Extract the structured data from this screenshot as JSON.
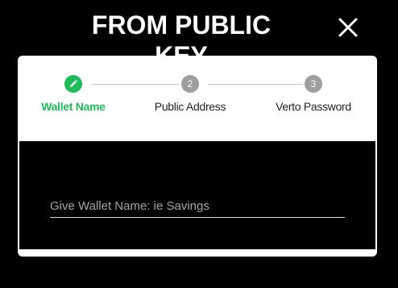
{
  "dialog": {
    "title": "FROM PUBLIC KEY",
    "close_icon": "close-icon"
  },
  "stepper": {
    "steps": [
      {
        "label": "Wallet Name",
        "number": "",
        "icon": "pencil-icon",
        "state": "active"
      },
      {
        "label": "Public Address",
        "number": "2",
        "state": "pending"
      },
      {
        "label": "Verto Password",
        "number": "3",
        "state": "pending"
      }
    ]
  },
  "form": {
    "wallet_name": {
      "value": "",
      "placeholder": "Give Wallet Name: ie Savings"
    }
  },
  "colors": {
    "accent": "#1fbc5a",
    "pending": "#9e9e9e",
    "background": "#000000",
    "card": "#ffffff"
  }
}
